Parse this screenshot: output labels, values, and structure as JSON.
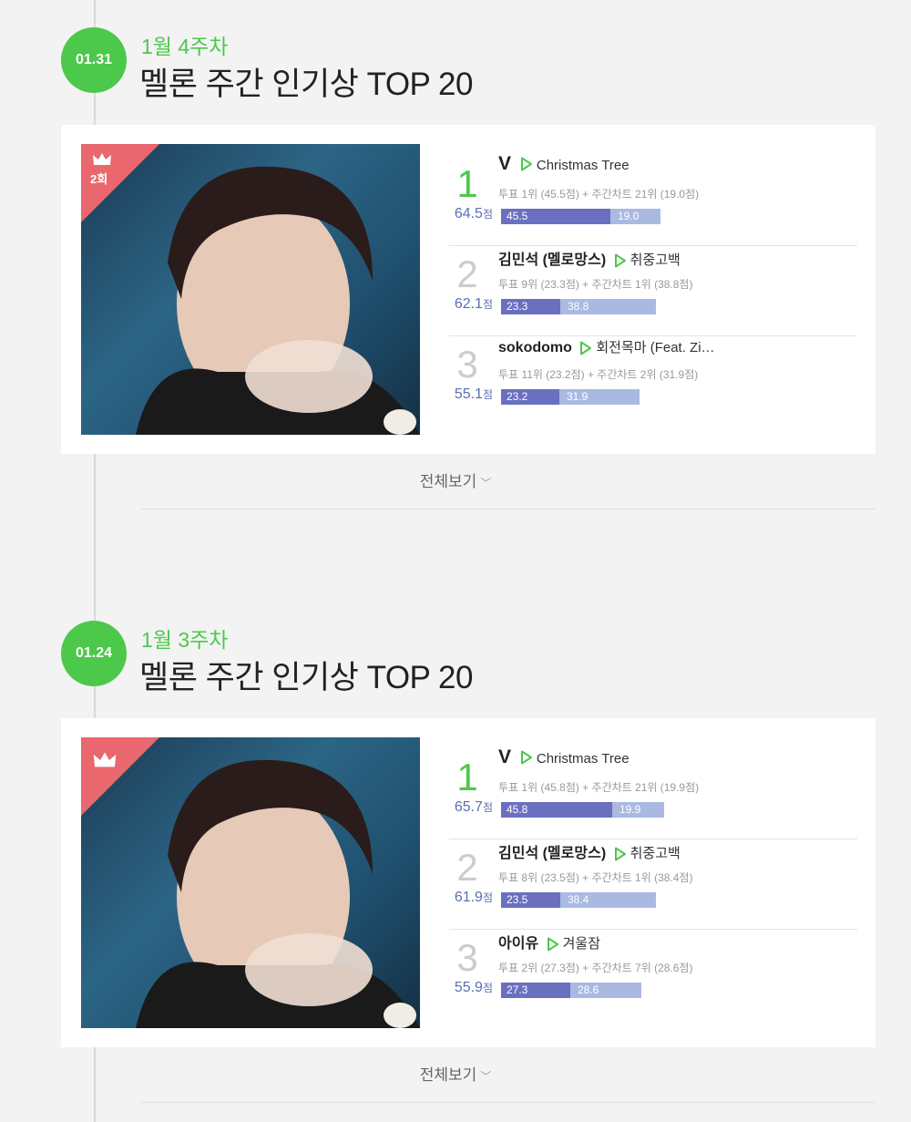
{
  "weeks": [
    {
      "date": "01.31",
      "label": "1월 4주차",
      "title": "멜론 주간 인기상 TOP 20",
      "crown_count": "2회",
      "more": "전체보기",
      "ranks": [
        {
          "rank": "1",
          "artist": "V",
          "song": "Christmas Tree",
          "detail": "투표 1위 (45.5점) + 주간차트 21위 (19.0점)",
          "score": "64.5",
          "unit": "점",
          "vote": "45.5",
          "chart": "19.0"
        },
        {
          "rank": "2",
          "artist": "김민석 (멜로망스)",
          "song": "취중고백",
          "detail": "투표 9위 (23.3점) + 주간차트 1위 (38.8점)",
          "score": "62.1",
          "unit": "점",
          "vote": "23.3",
          "chart": "38.8"
        },
        {
          "rank": "3",
          "artist": "sokodomo",
          "song": "회전목마 (Feat. Zi…",
          "detail": "투표 11위 (23.2점) + 주간차트 2위 (31.9점)",
          "score": "55.1",
          "unit": "점",
          "vote": "23.2",
          "chart": "31.9"
        }
      ]
    },
    {
      "date": "01.24",
      "label": "1월 3주차",
      "title": "멜론 주간 인기상 TOP 20",
      "crown_count": "",
      "more": "전체보기",
      "ranks": [
        {
          "rank": "1",
          "artist": "V",
          "song": "Christmas Tree",
          "detail": "투표 1위 (45.8점) + 주간차트 21위 (19.9점)",
          "score": "65.7",
          "unit": "점",
          "vote": "45.8",
          "chart": "19.9"
        },
        {
          "rank": "2",
          "artist": "김민석 (멜로망스)",
          "song": "취중고백",
          "detail": "투표 8위 (23.5점) + 주간차트 1위 (38.4점)",
          "score": "61.9",
          "unit": "점",
          "vote": "23.5",
          "chart": "38.4"
        },
        {
          "rank": "3",
          "artist": "아이유",
          "song": "겨울잠",
          "detail": "투표 2위 (27.3점) + 주간차트 7위 (28.6점)",
          "score": "55.9",
          "unit": "점",
          "vote": "27.3",
          "chart": "28.6"
        }
      ]
    }
  ],
  "colors": {
    "accent": "#4cc84a",
    "vote_bar": "#6a6fc0",
    "chart_bar": "#a9b9e2",
    "crown_bg": "#e9676d"
  },
  "icons": {
    "play": "play-triangle-icon",
    "crown": "crown-icon",
    "more": "chevron-down-icon"
  }
}
